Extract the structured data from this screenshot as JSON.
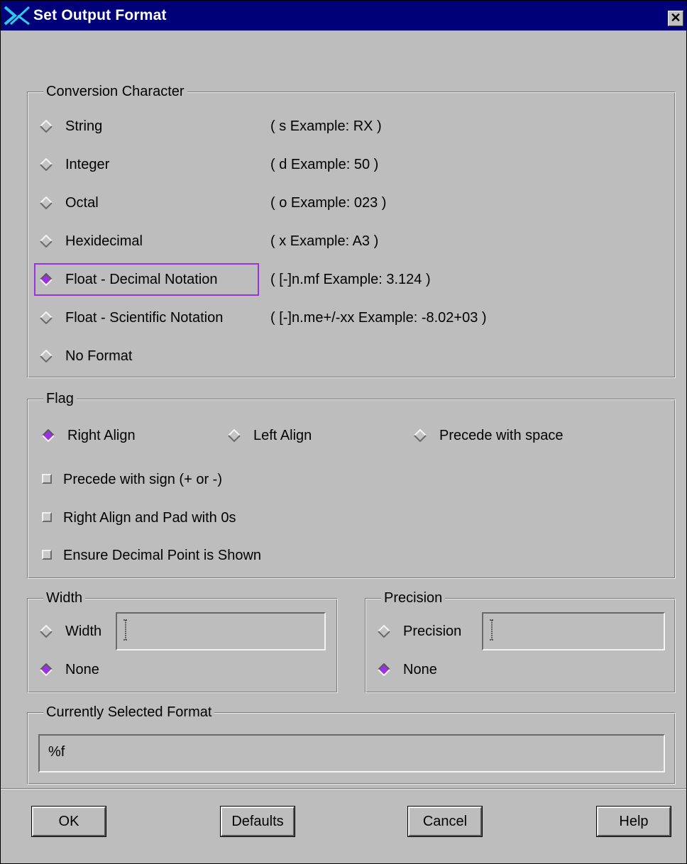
{
  "window": {
    "title": "Set Output Format",
    "close_glyph": "✕"
  },
  "conversion": {
    "legend": "Conversion Character",
    "options": [
      {
        "label": "String",
        "example": "( s Example:  RX )",
        "selected": false
      },
      {
        "label": "Integer",
        "example": "( d Example: 50 )",
        "selected": false
      },
      {
        "label": "Octal",
        "example": "( o Example: 023 )",
        "selected": false
      },
      {
        "label": "Hexidecimal",
        "example": "( x Example: A3 )",
        "selected": false
      },
      {
        "label": "Float - Decimal Notation",
        "example": "( [-]n.mf Example: 3.124 )",
        "selected": true
      },
      {
        "label": "Float - Scientific Notation",
        "example": "( [-]n.me+/-xx Example: -8.02+03 )",
        "selected": false
      },
      {
        "label": "No Format",
        "example": "",
        "selected": false
      }
    ]
  },
  "flag": {
    "legend": "Flag",
    "align_options": [
      {
        "label": "Right Align",
        "selected": true
      },
      {
        "label": "Left Align",
        "selected": false
      },
      {
        "label": "Precede with space",
        "selected": false
      }
    ],
    "checkboxes": [
      {
        "label": "Precede with sign (+ or -)",
        "checked": false
      },
      {
        "label": "Right Align and Pad with 0s",
        "checked": false
      },
      {
        "label": "Ensure Decimal Point is Shown",
        "checked": false
      }
    ]
  },
  "width": {
    "legend": "Width",
    "width_label": "Width",
    "width_value": "",
    "width_selected": false,
    "none_label": "None",
    "none_selected": true
  },
  "precision": {
    "legend": "Precision",
    "precision_label": "Precision",
    "precision_value": "",
    "precision_selected": false,
    "none_label": "None",
    "none_selected": true
  },
  "current": {
    "legend": "Currently Selected Format",
    "value": "%f"
  },
  "buttons": {
    "ok": "OK",
    "defaults": "Defaults",
    "cancel": "Cancel",
    "help": "Help"
  },
  "colors": {
    "titlebar": "#000078",
    "dialog_bg": "#bdbdbd",
    "radio_selected": "#9a32e0",
    "highlight_border": "#9a32e0"
  }
}
